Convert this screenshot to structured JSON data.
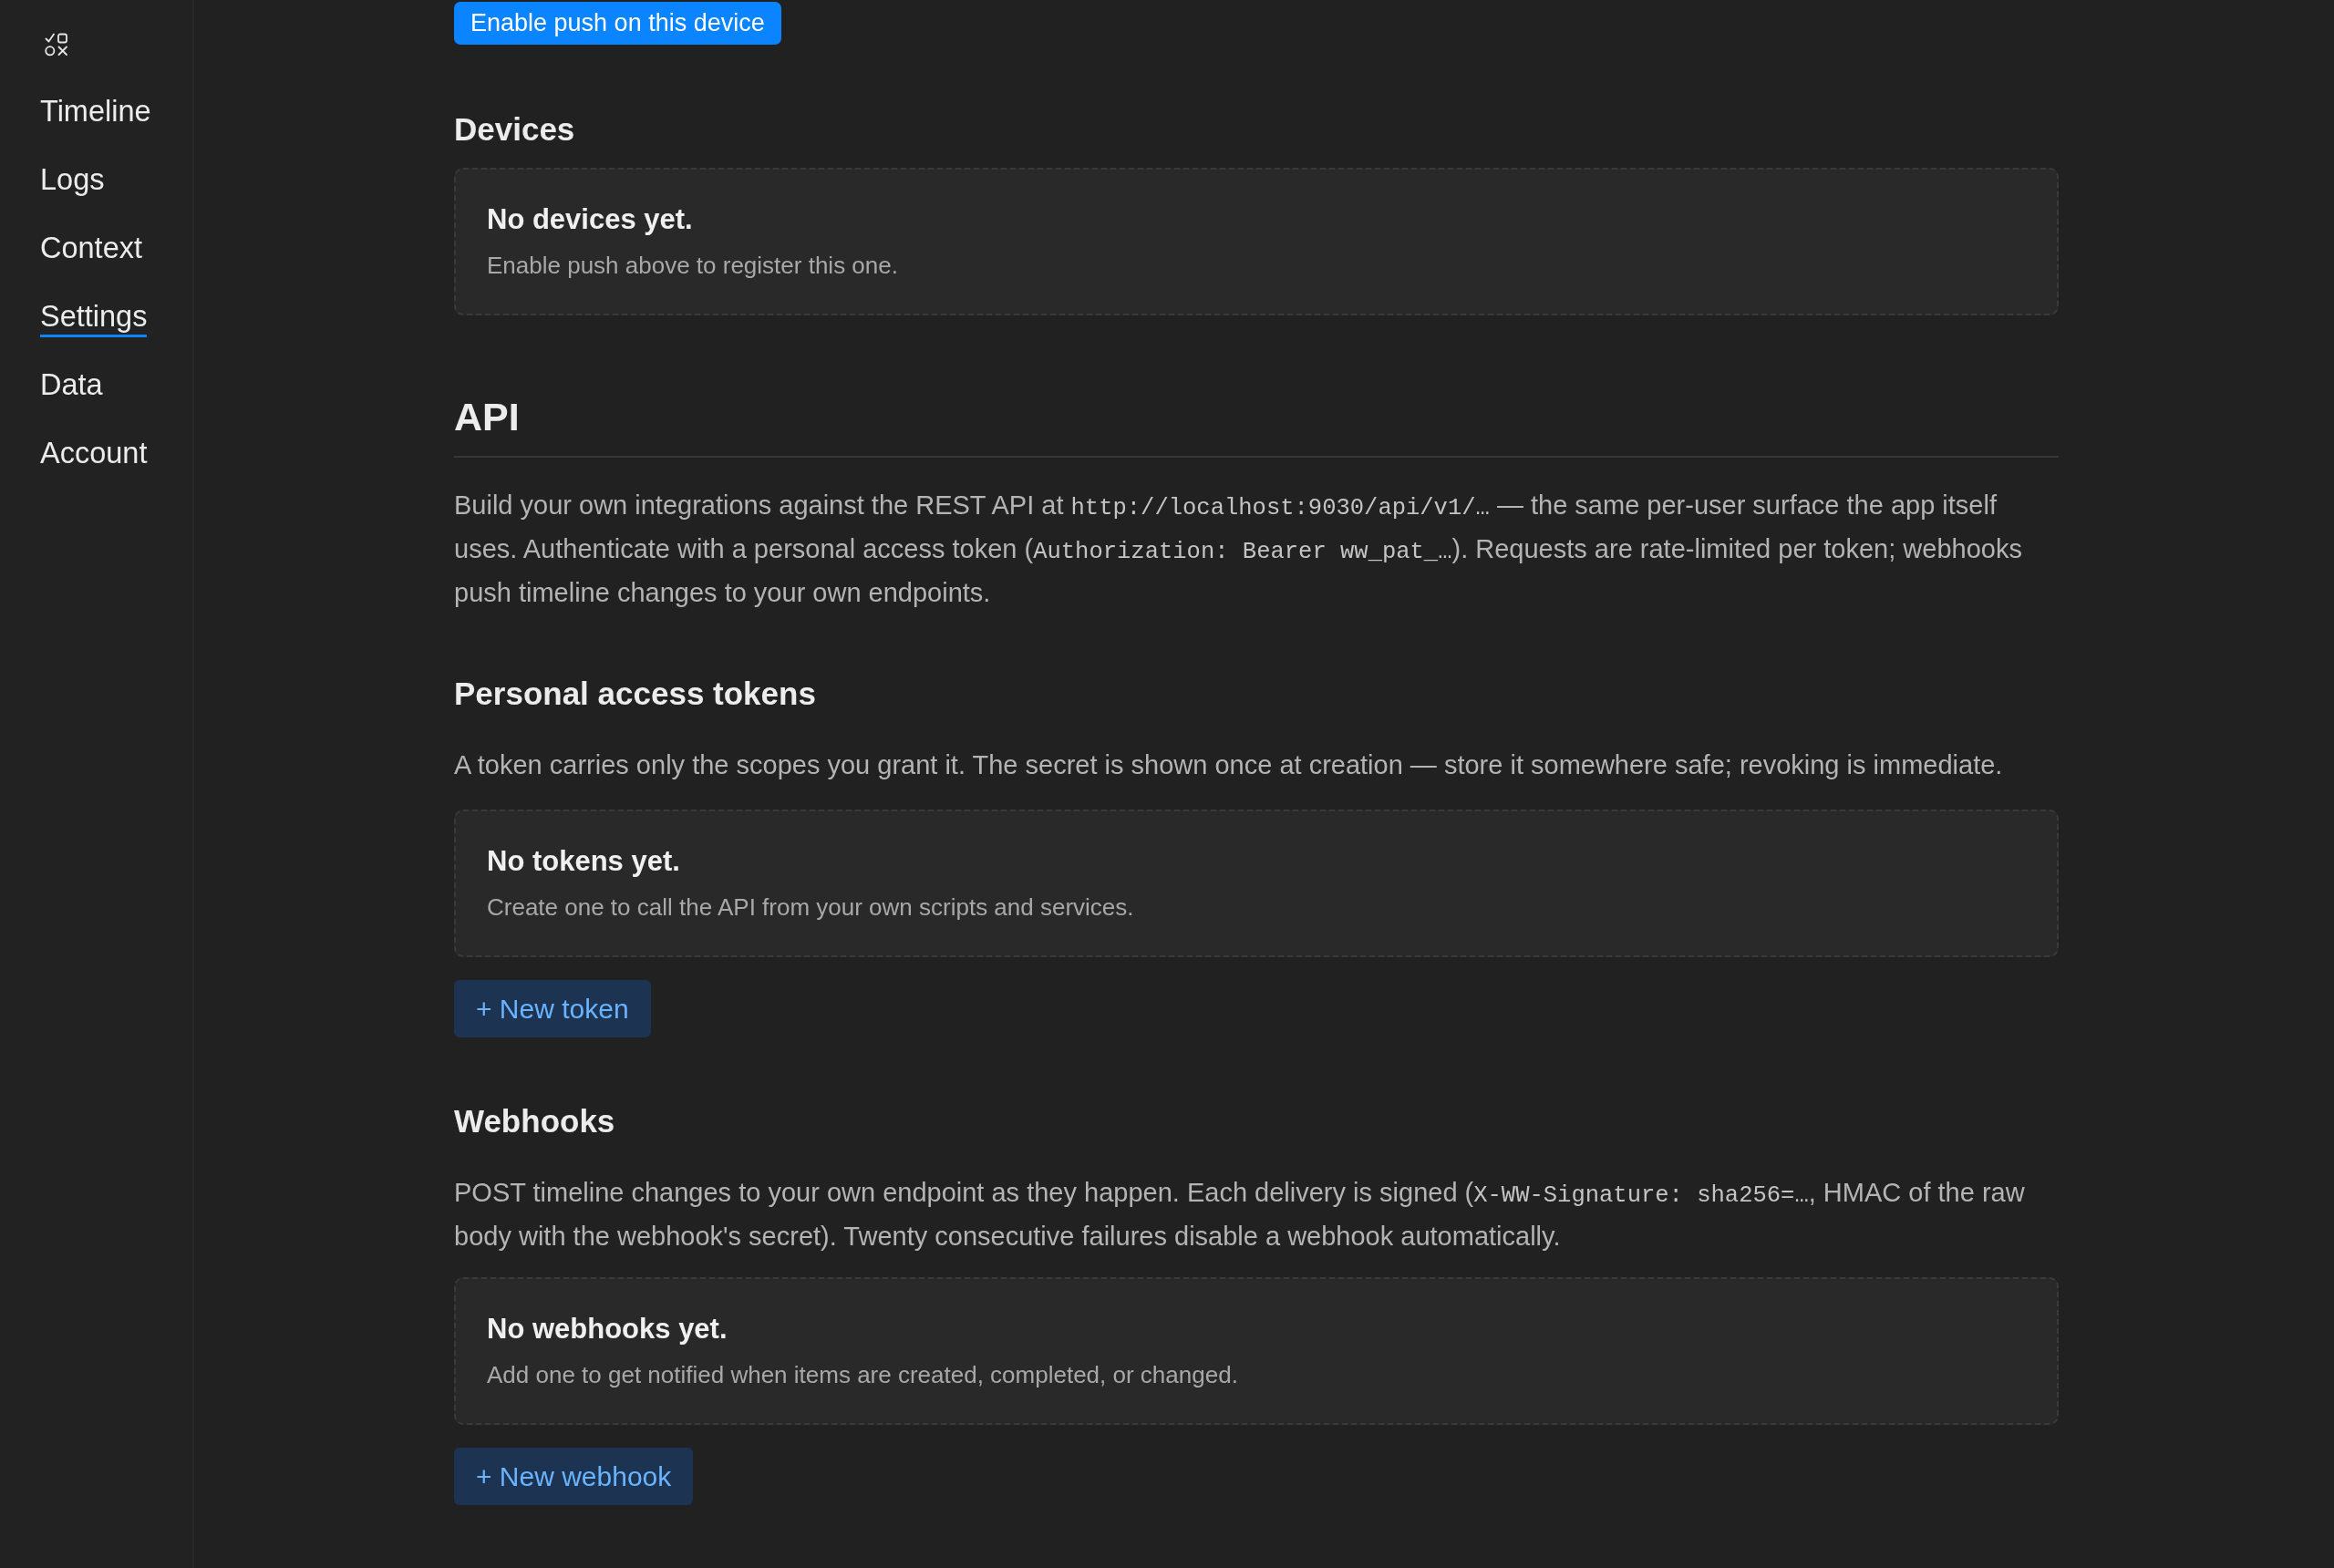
{
  "sidebar": {
    "items": [
      {
        "label": "Timeline",
        "selected": false
      },
      {
        "label": "Logs",
        "selected": false
      },
      {
        "label": "Context",
        "selected": false
      },
      {
        "label": "Settings",
        "selected": true
      },
      {
        "label": "Data",
        "selected": false
      },
      {
        "label": "Account",
        "selected": false
      }
    ]
  },
  "push": {
    "button": "Enable push on this device"
  },
  "devices": {
    "heading": "Devices",
    "empty_state": {
      "title": "No devices yet.",
      "text": "Enable push above to register this one."
    }
  },
  "api": {
    "heading": "API",
    "description": [
      {
        "kind": "text",
        "text": "Build your own integrations against the REST API at "
      },
      {
        "kind": "code",
        "text": "http://localhost:9030/api/v1/…"
      },
      {
        "kind": "text",
        "text": " — the same per-user surface the app itself uses. Authenticate with a personal access token ("
      },
      {
        "kind": "code",
        "text": "Authorization: Bearer ww_pat_…"
      },
      {
        "kind": "text",
        "text": "). Requests are rate-limited per token; webhooks push timeline changes to your own endpoints."
      }
    ]
  },
  "tokens": {
    "heading": "Personal access tokens",
    "description": [
      {
        "kind": "text",
        "text": "A token carries only the scopes you grant it. The secret is shown once at creation — store it somewhere safe; revoking is immediate."
      }
    ],
    "empty_state": {
      "title": "No tokens yet.",
      "text": "Create one to call the API from your own scripts and services."
    },
    "button": "+ New token"
  },
  "webhooks": {
    "heading": "Webhooks",
    "description": [
      {
        "kind": "text",
        "text": "POST timeline changes to your own endpoint as they happen. Each delivery is signed ("
      },
      {
        "kind": "code",
        "text": "X-WW-Signature: sha256=…"
      },
      {
        "kind": "text",
        "text": ", HMAC of the raw body with the webhook's secret). Twenty consecutive failures disable a webhook automatically."
      }
    ],
    "empty_state": {
      "title": "No webhooks yet.",
      "text": "Add one to get notified when items are created, completed, or changed."
    },
    "button": "+ New webhook"
  }
}
